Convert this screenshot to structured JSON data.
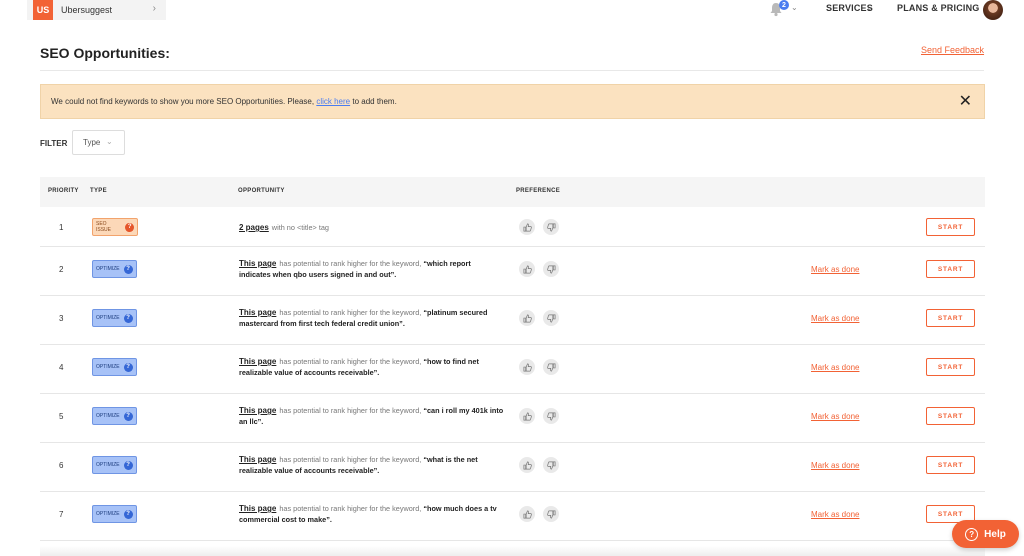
{
  "brand": {
    "logo": "US",
    "name": "Ubersuggest",
    "chevron": "›"
  },
  "nav": {
    "bell_count": "2",
    "services": "SERVICES",
    "plans": "PLANS & PRICING"
  },
  "page": {
    "title": "SEO Opportunities:",
    "feedback": "Send Feedback"
  },
  "notice": {
    "text_before": "We could not find keywords to show you more SEO Opportunities. Please, ",
    "link": "click here",
    "text_after": " to add them.",
    "close": "✕"
  },
  "filter": {
    "label": "FILTER",
    "value": "Type"
  },
  "table": {
    "headers": {
      "priority": "PRIORITY",
      "type": "TYPE",
      "opportunity": "OPPORTUNITY",
      "preference": "PREFERENCE"
    },
    "mark_done_label": "Mark as done",
    "start_label": "START",
    "rows": [
      {
        "priority": "1",
        "type": "SEO ISSUE",
        "link": "2 pages",
        "text": "with no <title> tag",
        "keyword": ""
      },
      {
        "priority": "2",
        "type": "OPTIMIZE",
        "link": "This page",
        "text": "has potential to rank higher for the keyword,",
        "keyword": "“which report indicates when qbo users signed in and out”."
      },
      {
        "priority": "3",
        "type": "OPTIMIZE",
        "link": "This page",
        "text": "has potential to rank higher for the keyword,",
        "keyword": "“platinum secured mastercard from first tech federal credit union”."
      },
      {
        "priority": "4",
        "type": "OPTIMIZE",
        "link": "This page",
        "text": "has potential to rank higher for the keyword,",
        "keyword": "“how to find net realizable value of accounts receivable”."
      },
      {
        "priority": "5",
        "type": "OPTIMIZE",
        "link": "This page",
        "text": "has potential to rank higher for the keyword,",
        "keyword": "“can i roll my 401k into an llc”."
      },
      {
        "priority": "6",
        "type": "OPTIMIZE",
        "link": "This page",
        "text": "has potential to rank higher for the keyword,",
        "keyword": "“what is the net realizable value of accounts receivable”."
      },
      {
        "priority": "7",
        "type": "OPTIMIZE",
        "link": "This page",
        "text": "has potential to rank higher for the keyword,",
        "keyword": "“how much does a tv commercial cost to make”."
      }
    ]
  },
  "help": {
    "label": "Help",
    "icon": "?"
  },
  "colors": {
    "accent": "#f26235",
    "notice_bg": "#fbe2c0",
    "optimize_badge": "#a7c2f7",
    "seo_badge": "#fcd8b8"
  }
}
